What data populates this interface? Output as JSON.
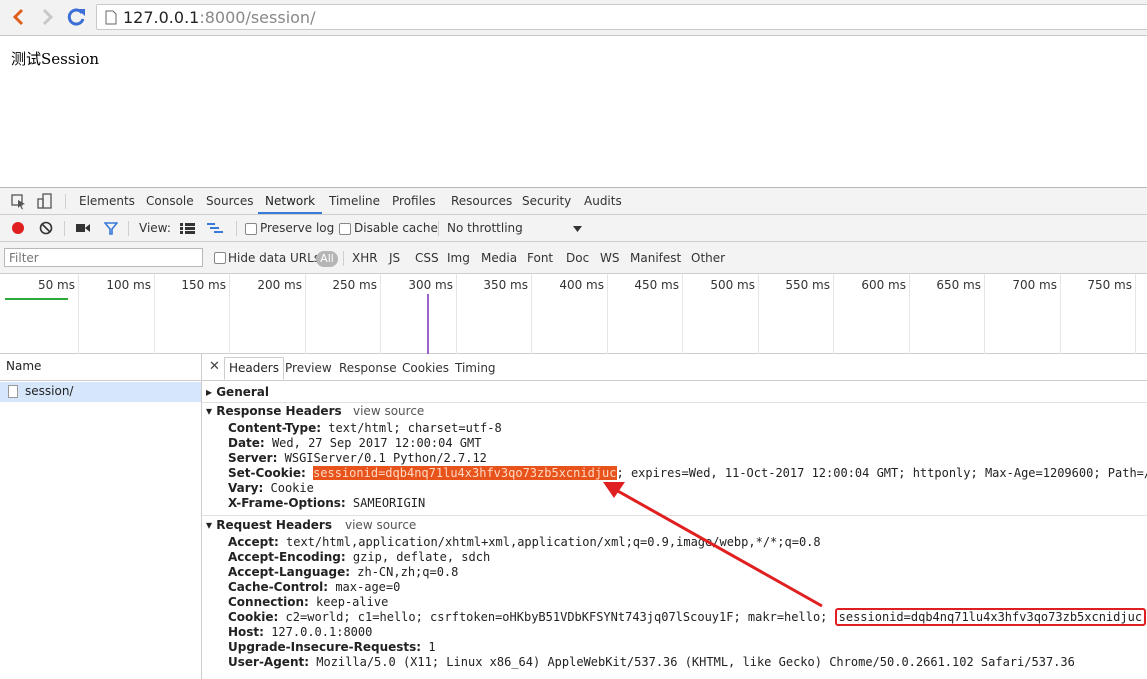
{
  "browser": {
    "url_host": "127.0.0.1",
    "url_path": ":8000/session/"
  },
  "page": {
    "heading": "测试Session"
  },
  "devtools": {
    "tabs": [
      "Elements",
      "Console",
      "Sources",
      "Network",
      "Timeline",
      "Profiles",
      "Resources",
      "Security",
      "Audits"
    ],
    "active_tab": "Network",
    "toolbar": {
      "view_label": "View:",
      "preserve_log": "Preserve log",
      "disable_cache": "Disable cache",
      "throttling": "No throttling"
    },
    "filter": {
      "placeholder": "Filter",
      "hide_data_urls": "Hide data URLs",
      "all": "All",
      "types": [
        "XHR",
        "JS",
        "CSS",
        "Img",
        "Media",
        "Font",
        "Doc",
        "WS",
        "Manifest",
        "Other"
      ]
    },
    "timeline_ticks": [
      "50 ms",
      "100 ms",
      "150 ms",
      "200 ms",
      "250 ms",
      "300 ms",
      "350 ms",
      "400 ms",
      "450 ms",
      "500 ms",
      "550 ms",
      "600 ms",
      "650 ms",
      "700 ms",
      "750 ms"
    ],
    "requests": {
      "column_name": "Name",
      "items": [
        "session/"
      ]
    },
    "detail": {
      "tabs": [
        "Headers",
        "Preview",
        "Response",
        "Cookies",
        "Timing"
      ],
      "active_tab": "Headers",
      "general_title": "General",
      "view_source": "view source",
      "response_title": "Response Headers",
      "response_headers": [
        {
          "key": "Content-Type:",
          "value": " text/html; charset=utf-8"
        },
        {
          "key": "Date:",
          "value": " Wed, 27 Sep 2017 12:00:04 GMT"
        },
        {
          "key": "Server:",
          "value": " WSGIServer/0.1 Python/2.7.12"
        },
        {
          "key": "Set-Cookie:",
          "value": " ",
          "highlight": "sessionid=dqb4nq71lu4x3hfv3qo73zb5xcnidjuc",
          "rest": "; expires=Wed, 11-Oct-2017 12:00:04 GMT; httponly; Max-Age=1209600; Path=/"
        },
        {
          "key": "Vary:",
          "value": " Cookie"
        },
        {
          "key": "X-Frame-Options:",
          "value": " SAMEORIGIN"
        }
      ],
      "request_title": "Request Headers",
      "request_headers": [
        {
          "key": "Accept:",
          "value": " text/html,application/xhtml+xml,application/xml;q=0.9,image/webp,*/*;q=0.8"
        },
        {
          "key": "Accept-Encoding:",
          "value": " gzip, deflate, sdch"
        },
        {
          "key": "Accept-Language:",
          "value": " zh-CN,zh;q=0.8"
        },
        {
          "key": "Cache-Control:",
          "value": " max-age=0"
        },
        {
          "key": "Connection:",
          "value": " keep-alive"
        },
        {
          "key": "Cookie:",
          "value": " c2=world; c1=hello; csrftoken=oHKbyB51VDbKFSYNt743jq07lScouy1F; makr=hello; ",
          "boxed": "sessionid=dqb4nq71lu4x3hfv3qo73zb5xcnidjuc"
        },
        {
          "key": "Host:",
          "value": " 127.0.0.1:8000"
        },
        {
          "key": "Upgrade-Insecure-Requests:",
          "value": " 1"
        },
        {
          "key": "User-Agent:",
          "value": " Mozilla/5.0 (X11; Linux x86_64) AppleWebKit/537.36 (KHTML, like Gecko) Chrome/50.0.2661.102 Safari/537.36"
        }
      ]
    }
  },
  "colors": {
    "accent": "#3879d9",
    "highlight": "#e8521b",
    "annotation": "#e02020",
    "record": "#e02020"
  }
}
